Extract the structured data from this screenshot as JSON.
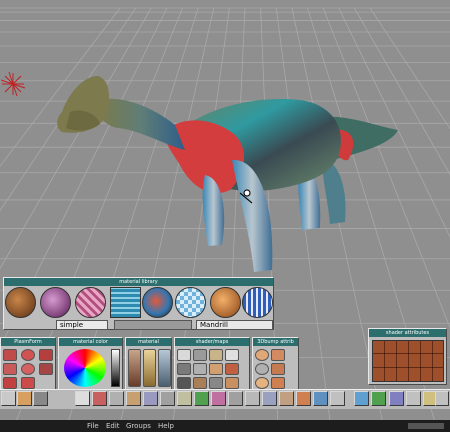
{
  "material_library": {
    "title": "material library",
    "shader_name": "simple",
    "texture_name": "Mandrill"
  },
  "palettes": {
    "plasmform": "PlasmForm",
    "material_color": "material color",
    "material": "material",
    "shader_maps": "shader/maps",
    "bump_attr": "3Dbump attrib",
    "shader_attributes": "shader attributes"
  },
  "menu": {
    "file": "File",
    "edit": "Edit",
    "groups": "Groups",
    "help": "Help"
  },
  "colors": {
    "background": "#8f8f8f",
    "grid": "#a9a9a9",
    "title_bar": "#2c6e6e",
    "panel": "#bdbdbd"
  },
  "icons": {
    "viewport_light": "star-burst-light-icon",
    "cursor": "wand-cursor-icon"
  }
}
